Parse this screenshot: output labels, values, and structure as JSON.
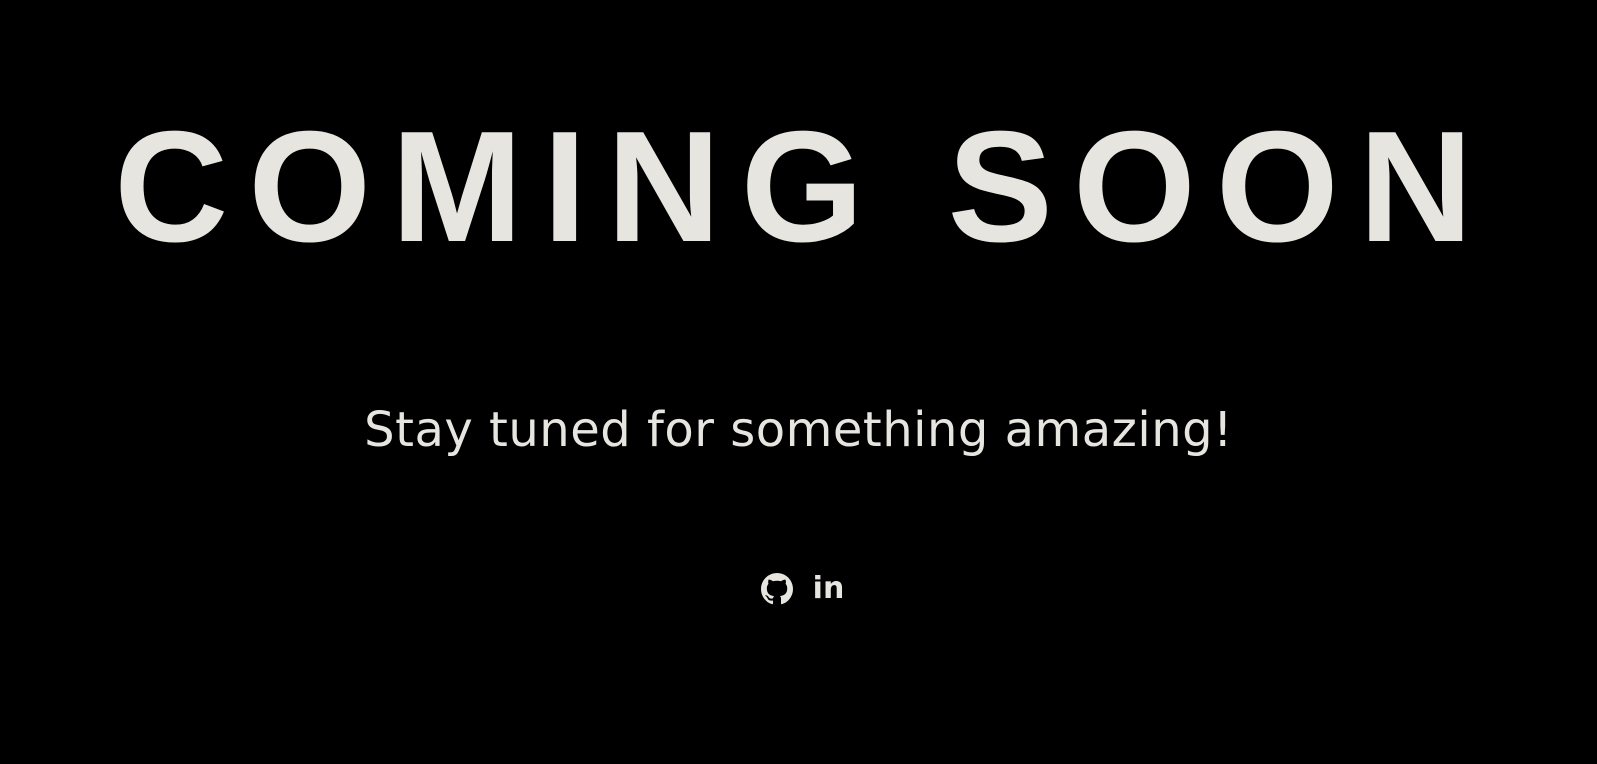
{
  "headline": "COMING SOON",
  "tagline": "Stay tuned for something amazing!",
  "socials": [
    {
      "name": "GitHub",
      "icon": "github-icon"
    },
    {
      "name": "LinkedIn",
      "icon": "linkedin-icon",
      "glyph": "in"
    }
  ],
  "colors": {
    "background": "#000000",
    "text": "#e6e5e0"
  }
}
